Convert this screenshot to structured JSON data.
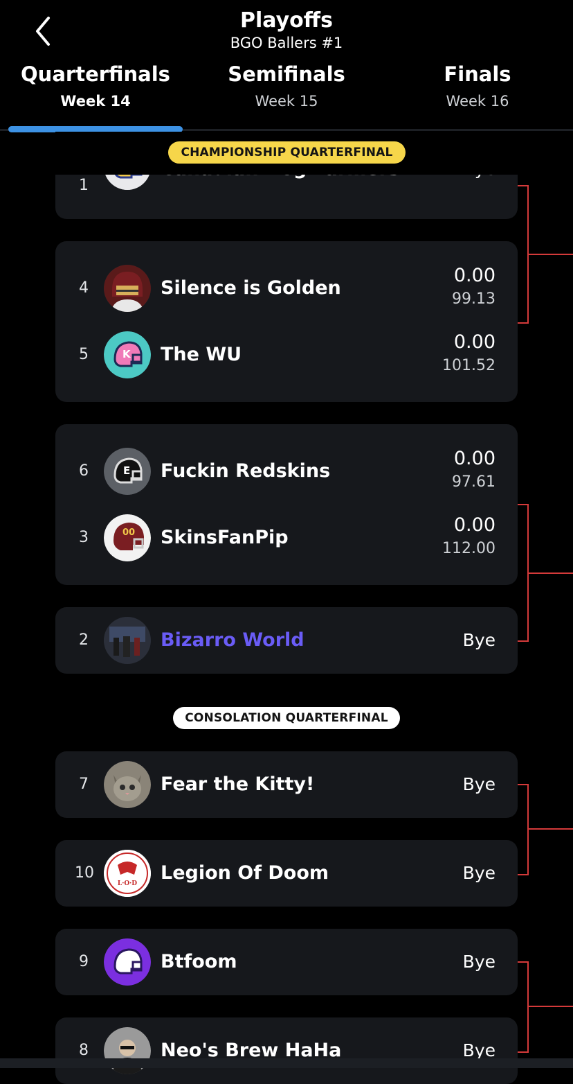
{
  "header": {
    "title": "Playoffs",
    "subtitle": "BGO Ballers #1",
    "back_icon": "chevron-left-icon"
  },
  "tabs": [
    {
      "label": "Quarterfinals",
      "week": "Week 14",
      "active": true
    },
    {
      "label": "Semifinals",
      "week": "Week 15",
      "active": false
    },
    {
      "label": "Finals",
      "week": "Week 16",
      "active": false
    }
  ],
  "sections": {
    "championship": "CHAMPIONSHIP QUARTERFINAL",
    "consolation": "CONSOLATION QUARTERFINAL"
  },
  "teams": {
    "canadian_hog_farmers": {
      "seed": "1",
      "name": "Canadian Hog Farmers",
      "result": "Bye"
    },
    "silence_is_golden": {
      "seed": "4",
      "name": "Silence is Golden",
      "score": "0.00",
      "projected": "99.13"
    },
    "the_wu": {
      "seed": "5",
      "name": "The WU",
      "score": "0.00",
      "projected": "101.52"
    },
    "fuckin_redskins": {
      "seed": "6",
      "name": "Fuckin Redskins",
      "score": "0.00",
      "projected": "97.61"
    },
    "skinsfanpip": {
      "seed": "3",
      "name": "SkinsFanPip",
      "score": "0.00",
      "projected": "112.00"
    },
    "bizarro_world": {
      "seed": "2",
      "name": "Bizarro World",
      "result": "Bye"
    },
    "fear_the_kitty": {
      "seed": "7",
      "name": "Fear the Kitty!",
      "result": "Bye"
    },
    "legion_of_doom": {
      "seed": "10",
      "name": "Legion Of Doom",
      "result": "Bye",
      "logo_text": "L·O·D"
    },
    "btfoom": {
      "seed": "9",
      "name": "Btfoom",
      "result": "Bye"
    },
    "neos_brew_haha": {
      "seed": "8",
      "name": "Neo's Brew HaHa",
      "result": "Bye"
    }
  },
  "colors": {
    "background": "#000000",
    "card": "#16181c",
    "accent_tab": "#3d92e4",
    "championship_pill": "#f6d64a",
    "user_team": "#6a5cf6",
    "bracket_line": "#d43a3a"
  }
}
